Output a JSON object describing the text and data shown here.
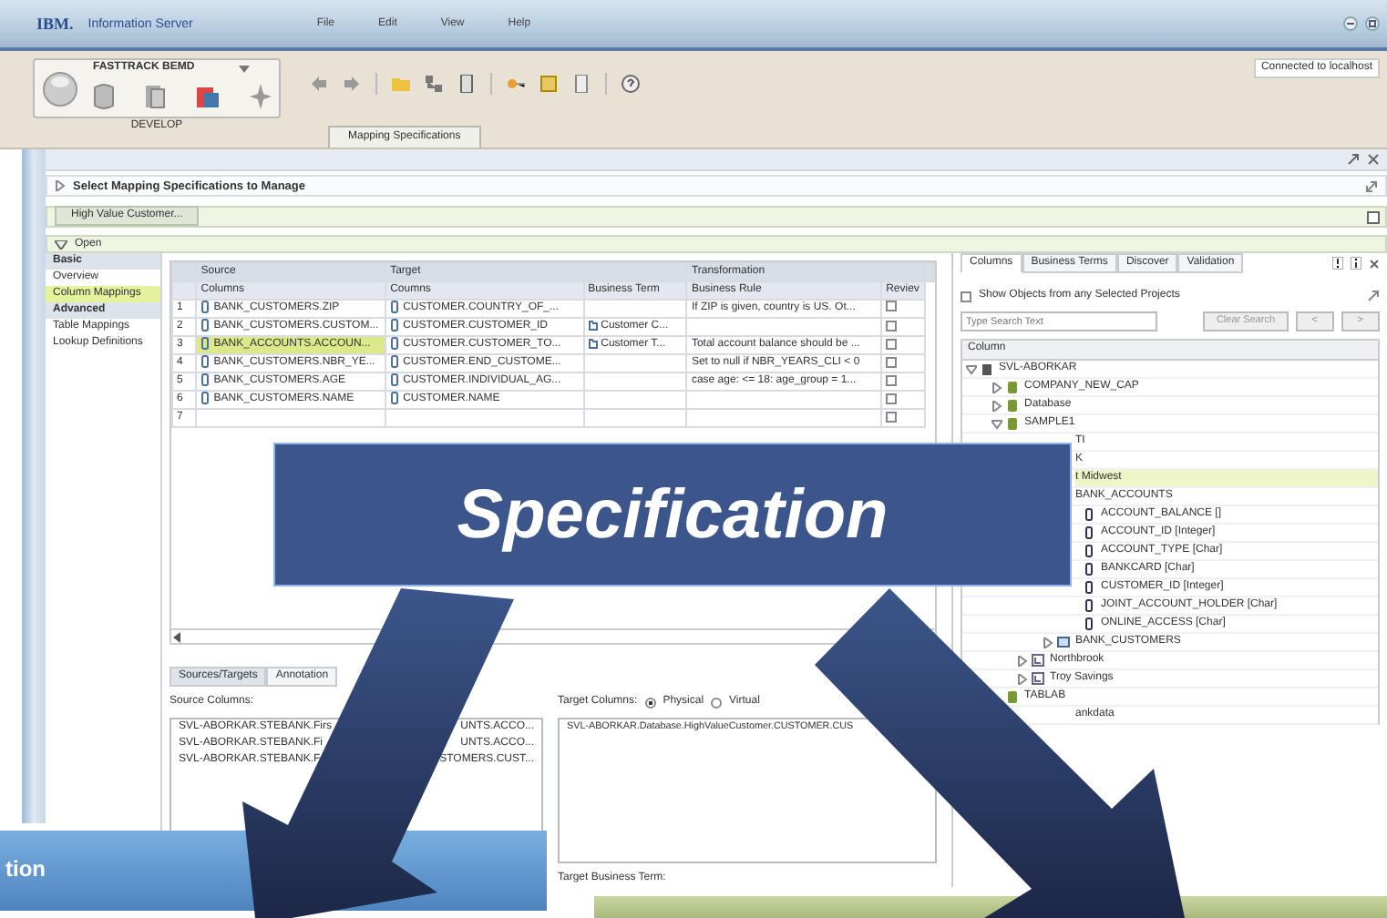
{
  "window": {
    "logo": "IBM.",
    "title": "Information Server",
    "menu": [
      "File",
      "Edit",
      "View",
      "Help"
    ],
    "connection": "Connected to localhost"
  },
  "workspace": {
    "name": "FASTTRACK BEMD",
    "label": "DEVELOP"
  },
  "perspective_tabs": [
    {
      "label": "Mapping Specifications",
      "selected": true
    }
  ],
  "section_title": "Select Mapping Specifications to Manage",
  "document_tabs": [
    {
      "label": "High Value Customer...",
      "selected": true
    }
  ],
  "open_label": "Open",
  "nav": [
    {
      "kind": "header",
      "label": "Basic"
    },
    {
      "kind": "item",
      "label": "Overview",
      "selected": false
    },
    {
      "kind": "item",
      "label": "Column Mappings",
      "selected": true
    },
    {
      "kind": "header",
      "label": "Advanced"
    },
    {
      "kind": "item",
      "label": "Table Mappings",
      "selected": false
    },
    {
      "kind": "item",
      "label": "Lookup Definitions",
      "selected": false
    }
  ],
  "grid": {
    "groups": [
      "Source",
      "Target",
      "Transformation"
    ],
    "columns": [
      "Columns",
      "Coumns",
      "Business Term",
      "Business Rule",
      "Reviev"
    ],
    "rows": [
      {
        "number": "1",
        "source": "BANK_CUSTOMERS.ZIP",
        "target": "CUSTOMER.COUNTRY_OF_...",
        "rule": "If ZIP is given, country is US. Ot...",
        "reviewed": false,
        "selected": false
      },
      {
        "number": "2",
        "source": "BANK_CUSTOMERS.CUSTOM...",
        "target": "CUSTOMER.CUSTOMER_ID",
        "term": "Customer C...",
        "reviewed": false,
        "selected": false
      },
      {
        "number": "3",
        "source": "BANK_ACCOUNTS.ACCOUN...",
        "target": "CUSTOMER.CUSTOMER_TO...",
        "term": "Customer T...",
        "rule": "Total account balance should be ...",
        "reviewed": false,
        "selected": true
      },
      {
        "number": "4",
        "source": "BANK_CUSTOMERS.NBR_YE...",
        "target": "CUSTOMER.END_CUSTOME...",
        "rule": "Set to null if NBR_YEARS_CLI < 0",
        "reviewed": false,
        "selected": false
      },
      {
        "number": "5",
        "source": "BANK_CUSTOMERS.AGE",
        "target": "CUSTOMER.INDIVIDUAL_AG...",
        "rule": "case age: <= 18: age_group = 1...",
        "reviewed": false,
        "selected": false
      },
      {
        "number": "6",
        "source": "BANK_CUSTOMERS.NAME",
        "target": "CUSTOMER.NAME",
        "reviewed": false,
        "selected": false
      },
      {
        "number": "7",
        "reviewed": false,
        "selected": false
      }
    ]
  },
  "bottom_tabs": [
    {
      "label": "Sources/Targets",
      "selected": true
    },
    {
      "label": "Annotation",
      "selected": false
    }
  ],
  "source_columns": {
    "label": "Source Columns:",
    "items": [
      {
        "head": "SVL-ABORKAR.STEBANK.Firs",
        "tail": "UNTS.ACCO..."
      },
      {
        "head": "SVL-ABORKAR.STEBANK.Fi",
        "tail": "UNTS.ACCO..."
      },
      {
        "head": "SVL-ABORKAR.STEBANK.F",
        "tail": "STOMERS.CUST..."
      }
    ]
  },
  "target_columns": {
    "label": "Target Columns:",
    "options": [
      {
        "label": "Physical",
        "selected": true
      },
      {
        "label": "Virtual",
        "selected": false
      }
    ],
    "items": [
      "SVL-ABORKAR.Database.HighValueCustomer.CUSTOMER.CUS"
    ],
    "term_label": "Target Business Term:"
  },
  "browser": {
    "tabs": [
      {
        "label": "Columns",
        "selected": true
      },
      {
        "label": "Business Terms",
        "selected": false
      },
      {
        "label": "Discover",
        "selected": false
      },
      {
        "label": "Validation",
        "selected": false
      }
    ],
    "show_all": {
      "label": "Show Objects from any Selected Projects",
      "checked": false
    },
    "search": {
      "placeholder": "Type Search Text"
    },
    "buttons": [
      "Clear Search",
      "<",
      ">"
    ],
    "header": "Column",
    "tree": [
      {
        "kind": "server",
        "label": "SVL-ABORKAR",
        "expanded": true,
        "children": [
          {
            "kind": "database",
            "label": "COMPANY_NEW_CAP",
            "expanded": false
          },
          {
            "kind": "database",
            "label": "Database",
            "expanded": false
          },
          {
            "kind": "database",
            "label": "SAMPLE1",
            "expanded": true,
            "children": [
              {
                "kind": "partial",
                "label": "TI"
              },
              {
                "kind": "partial",
                "label": "K"
              },
              {
                "kind": "partial",
                "label": "t Midwest",
                "selected": true,
                "children": [
                  {
                    "kind": "partial",
                    "label": "BANK_ACCOUNTS",
                    "children": [
                      {
                        "kind": "column",
                        "label": "ACCOUNT_BALANCE []"
                      },
                      {
                        "kind": "column",
                        "label": "ACCOUNT_ID [Integer]"
                      },
                      {
                        "kind": "column",
                        "label": "ACCOUNT_TYPE [Char]"
                      },
                      {
                        "kind": "column",
                        "label": "BANKCARD [Char]"
                      },
                      {
                        "kind": "column",
                        "label": "CUSTOMER_ID [Integer]"
                      },
                      {
                        "kind": "column",
                        "label": "JOINT_ACCOUNT_HOLDER [Char]"
                      },
                      {
                        "kind": "column",
                        "label": "ONLINE_ACCESS [Char]"
                      }
                    ]
                  },
                  {
                    "kind": "table",
                    "label": "BANK_CUSTOMERS",
                    "expanded": false
                  }
                ]
              },
              {
                "kind": "schema",
                "label": "Northbrook",
                "expanded": false
              },
              {
                "kind": "schema",
                "label": "Troy Savings",
                "expanded": false
              }
            ]
          },
          {
            "kind": "database",
            "label": "TABLAB"
          },
          {
            "kind": "partial",
            "label": "ankdata"
          }
        ]
      }
    ]
  },
  "callout": {
    "label": "Specification"
  },
  "side_box": {
    "label": "tion"
  }
}
